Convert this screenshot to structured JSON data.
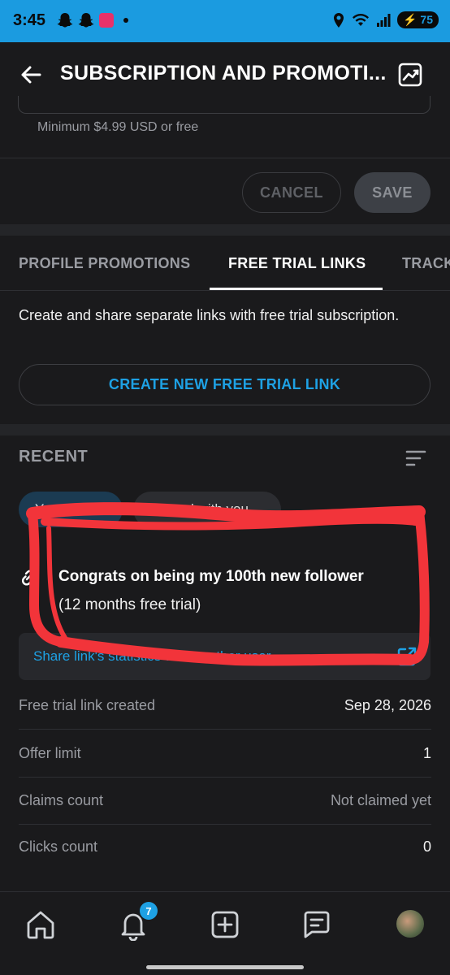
{
  "status_bar": {
    "time": "3:45",
    "battery": "75",
    "icons": [
      "snapchat-icon",
      "snapchat-icon",
      "app-icon",
      "dot",
      "location-icon",
      "wifi-icon",
      "signal-icon",
      "battery-icon"
    ]
  },
  "app_bar": {
    "title": "SUBSCRIPTION AND PROMOTI..."
  },
  "pricing": {
    "hint": "Minimum $4.99 USD or free",
    "cancel_label": "CANCEL",
    "save_label": "SAVE"
  },
  "tabs": [
    {
      "label": "PROFILE PROMOTIONS",
      "active": false
    },
    {
      "label": "FREE TRIAL LINKS",
      "active": true
    },
    {
      "label": "TRACK",
      "active": false
    }
  ],
  "free_trial": {
    "description": "Create and share separate links with free trial subscription.",
    "create_button": "CREATE NEW FREE TRIAL LINK"
  },
  "recent": {
    "heading": "RECENT",
    "chips": [
      "Your links",
      "Shared with you"
    ]
  },
  "offer": {
    "title": "Congrats on being my 100th new follower",
    "subtitle": "(12 months free trial)",
    "share_text": "Share link's statistics with another user"
  },
  "stats": [
    {
      "label": "Free trial link created",
      "value": "Sep 28, 2026"
    },
    {
      "label": "Offer limit",
      "value": "1"
    },
    {
      "label": "Claims count",
      "value": "Not claimed yet"
    },
    {
      "label": "Clicks count",
      "value": "0"
    }
  ],
  "bottom_nav": {
    "notification_count": "7",
    "items": [
      "home-icon",
      "notifications-icon",
      "add-post-icon",
      "messages-icon",
      "profile-avatar"
    ]
  },
  "colors": {
    "accent": "#1ea1e4",
    "status_bar": "#1b9be0",
    "background": "#1a1a1c",
    "annotation_red": "#f2343a"
  }
}
